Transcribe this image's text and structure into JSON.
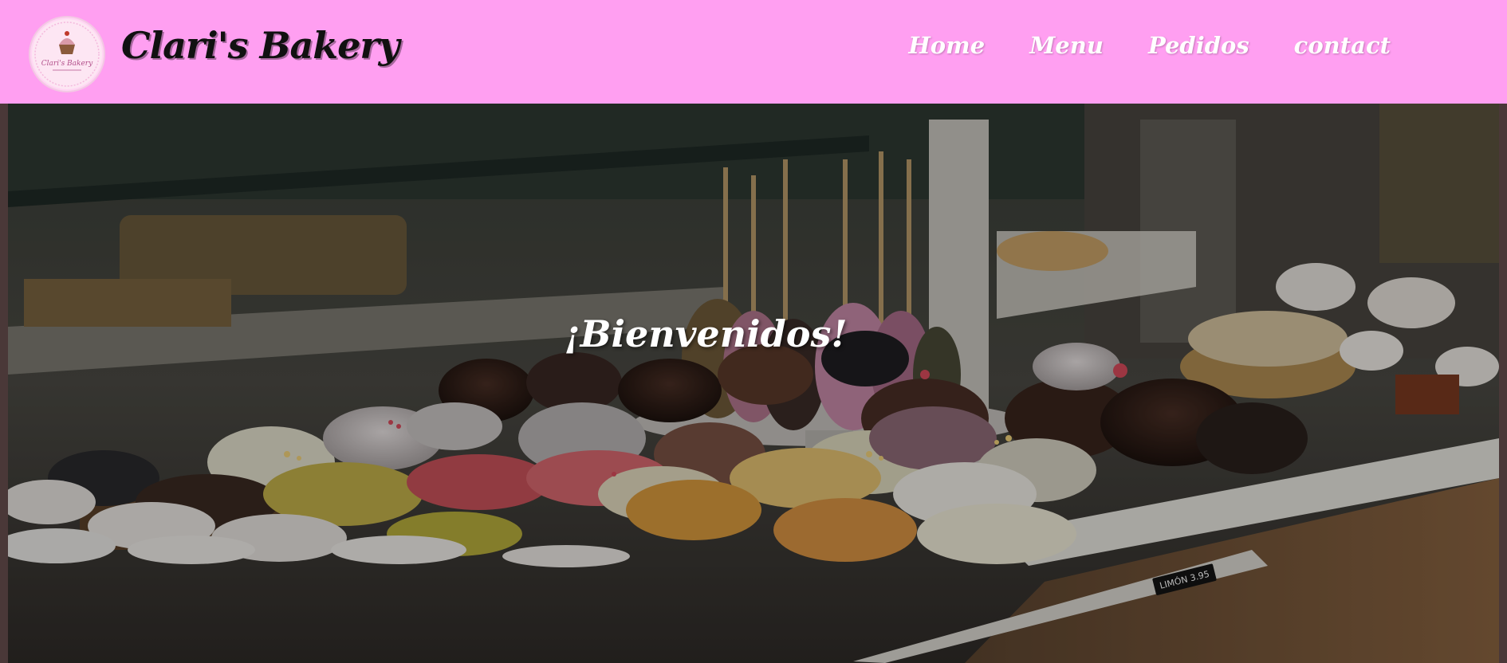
{
  "header": {
    "brand": "Clari's Bakery",
    "logo_text": "Clari's Bakery",
    "logo_icon": "cupcake-icon",
    "background_color": "#ff9ff1"
  },
  "nav": {
    "items": [
      {
        "label": "Home"
      },
      {
        "label": "Menu"
      },
      {
        "label": "Pedidos"
      },
      {
        "label": "contact"
      }
    ]
  },
  "hero": {
    "title": "¡Bienvenidos!",
    "image": "bakery-display-photo",
    "price_tag": "LIMÓN 3.95"
  }
}
